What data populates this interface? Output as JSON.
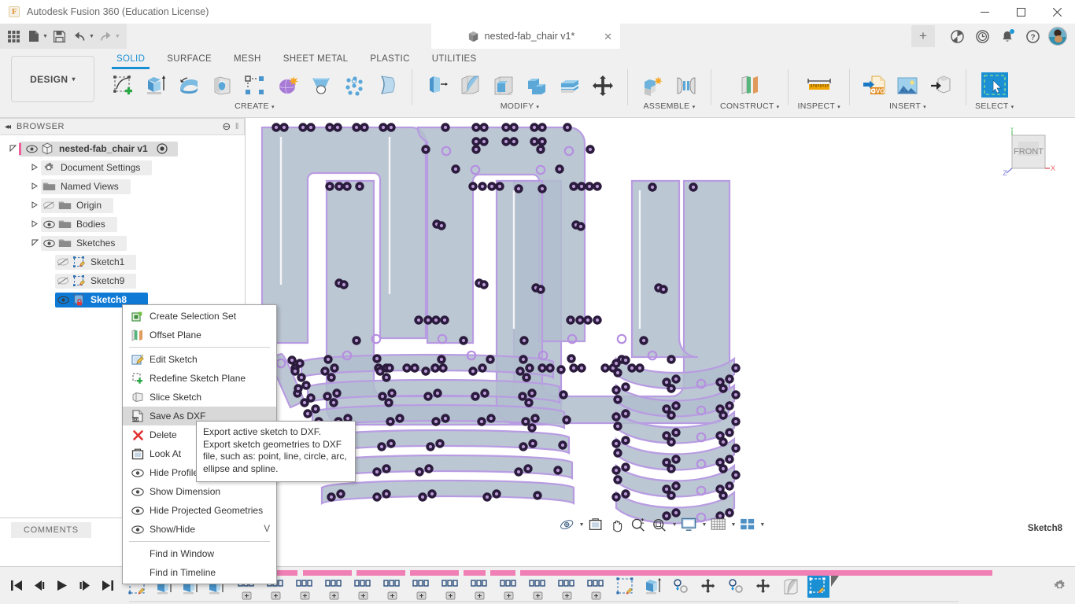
{
  "window": {
    "app_title": "Autodesk Fusion 360 (Education License)",
    "logo_letter": "F",
    "minimize": "—",
    "maximize": "☐",
    "close": "✕"
  },
  "quick_access": {
    "items": [
      {
        "name": "app-grid-icon",
        "label": "Show Data Panel"
      },
      {
        "name": "new-file-icon",
        "label": "File",
        "caret": true
      },
      {
        "name": "save-icon",
        "label": "Save"
      },
      {
        "name": "undo-icon",
        "label": "Undo",
        "caret": true
      },
      {
        "name": "redo-icon",
        "label": "Redo",
        "caret": true
      }
    ]
  },
  "document_tab": {
    "title": "nested-fab_chair v1*",
    "close": "✕",
    "new_tab": "+"
  },
  "system_icons": [
    {
      "name": "job-status-icon",
      "label": "Job Status"
    },
    {
      "name": "recent-activity-icon",
      "label": "Recent Activity"
    },
    {
      "name": "notifications-icon",
      "label": "Notifications"
    },
    {
      "name": "help-icon",
      "label": "Help"
    },
    {
      "name": "account-avatar",
      "label": "Account"
    }
  ],
  "ribbon": {
    "workspace": "DESIGN",
    "workspace_caret": "▾",
    "tabs": [
      {
        "label": "SOLID",
        "active": true
      },
      {
        "label": "SURFACE",
        "active": false
      },
      {
        "label": "MESH",
        "active": false
      },
      {
        "label": "SHEET METAL",
        "active": false
      },
      {
        "label": "PLASTIC",
        "active": false
      },
      {
        "label": "UTILITIES",
        "active": false
      }
    ],
    "panels": [
      {
        "label": "CREATE",
        "caret": "▾",
        "buttons": [
          {
            "name": "create-sketch-icon",
            "label": "Create Sketch"
          },
          {
            "name": "extrude-icon",
            "label": "Extrude"
          },
          {
            "name": "revolve-icon",
            "label": "Revolve"
          },
          {
            "name": "sweep-icon",
            "label": "Sweep"
          },
          {
            "name": "pattern-icon",
            "label": "Rectangular Pattern"
          },
          {
            "name": "create-form-icon",
            "label": "Create Form"
          },
          {
            "name": "loft-icon",
            "label": "Loft"
          },
          {
            "name": "hole-pattern-icon",
            "label": "Hole"
          },
          {
            "name": "rib-icon",
            "label": "Rib"
          }
        ]
      },
      {
        "label": "MODIFY",
        "caret": "▾",
        "buttons": [
          {
            "name": "press-pull-icon",
            "label": "Press Pull"
          },
          {
            "name": "fillet-icon",
            "label": "Fillet"
          },
          {
            "name": "shell-icon",
            "label": "Shell"
          },
          {
            "name": "combine-icon",
            "label": "Combine"
          },
          {
            "name": "split-face-icon",
            "label": "Split Face"
          },
          {
            "name": "move-copy-icon",
            "label": "Move/Copy"
          }
        ]
      },
      {
        "label": "ASSEMBLE",
        "caret": "▾",
        "buttons": [
          {
            "name": "new-component-icon",
            "label": "New Component"
          },
          {
            "name": "joint-icon",
            "label": "Joint"
          }
        ]
      },
      {
        "label": "CONSTRUCT",
        "caret": "▾",
        "buttons": [
          {
            "name": "offset-plane-icon",
            "label": "Offset Plane"
          }
        ]
      },
      {
        "label": "INSPECT",
        "caret": "▾",
        "buttons": [
          {
            "name": "measure-icon",
            "label": "Measure"
          }
        ]
      },
      {
        "label": "INSERT",
        "caret": "▾",
        "buttons": [
          {
            "name": "insert-svg-icon",
            "label": "Insert SVG"
          },
          {
            "name": "canvas-image-icon",
            "label": "Canvas"
          },
          {
            "name": "insert-derive-icon",
            "label": "Derive"
          }
        ]
      },
      {
        "label": "SELECT",
        "caret": "▾",
        "buttons": [
          {
            "name": "select-tool-icon",
            "label": "Select"
          }
        ]
      }
    ]
  },
  "browser": {
    "header": "BROWSER",
    "collapse_glyph": "◂◂",
    "minus_glyph": "⊖",
    "grip_glyph": "‖",
    "tree": [
      {
        "label": "nested-fab_chair v1",
        "depth": 0,
        "arrow": "open",
        "eye": "visible",
        "state": "root",
        "icon": "component-icon",
        "has_pink_bar": true,
        "has_target": true
      },
      {
        "label": "Document Settings",
        "depth": 1,
        "arrow": "closed",
        "eye": "none",
        "state": "normal",
        "icon": "gear-icon"
      },
      {
        "label": "Named Views",
        "depth": 1,
        "arrow": "closed",
        "eye": "none",
        "state": "normal",
        "icon": "folder-icon"
      },
      {
        "label": "Origin",
        "depth": 1,
        "arrow": "closed",
        "eye": "hidden",
        "state": "normal",
        "icon": "folder-icon"
      },
      {
        "label": "Bodies",
        "depth": 1,
        "arrow": "closed",
        "eye": "visible",
        "state": "normal",
        "icon": "folder-icon"
      },
      {
        "label": "Sketches",
        "depth": 1,
        "arrow": "open",
        "eye": "visible",
        "state": "normal",
        "icon": "folder-sketch-icon"
      },
      {
        "label": "Sketch1",
        "depth": 2,
        "arrow": "none",
        "eye": "hidden",
        "state": "normal",
        "icon": "sketch-icon"
      },
      {
        "label": "Sketch9",
        "depth": 2,
        "arrow": "none",
        "eye": "hidden",
        "state": "normal",
        "icon": "sketch-icon"
      },
      {
        "label": "Sketch8",
        "depth": 2,
        "arrow": "none",
        "eye": "visible",
        "state": "selected",
        "icon": "sketch-locked-icon"
      }
    ],
    "comments_label": "COMMENTS"
  },
  "context_menu": {
    "items": [
      {
        "label": "Create Selection Set",
        "icon": "selection-set-icon",
        "type": "item"
      },
      {
        "label": "Offset Plane",
        "icon": "offset-plane-icon",
        "type": "item"
      },
      {
        "type": "separator"
      },
      {
        "label": "Edit Sketch",
        "icon": "edit-sketch-icon",
        "type": "item"
      },
      {
        "label": "Redefine Sketch Plane",
        "icon": "redefine-plane-icon",
        "type": "item"
      },
      {
        "label": "Slice Sketch",
        "icon": "slice-sketch-icon",
        "type": "item"
      },
      {
        "label": "Save As DXF",
        "icon": "dxf-icon",
        "type": "item",
        "highlighted": true
      },
      {
        "label": "Delete",
        "icon": "delete-icon",
        "type": "item"
      },
      {
        "label": "Look At",
        "icon": "look-at-icon",
        "type": "item"
      },
      {
        "label": "Hide Profile",
        "icon": "eye-icon",
        "type": "item"
      },
      {
        "label": "Show Dimension",
        "icon": "eye-icon",
        "type": "item"
      },
      {
        "label": "Hide Projected Geometries",
        "icon": "eye-icon",
        "type": "item"
      },
      {
        "label": "Show/Hide",
        "icon": "eye-icon",
        "type": "item",
        "shortcut": "V"
      },
      {
        "type": "separator"
      },
      {
        "label": "Find in Window",
        "icon": "none",
        "type": "item"
      },
      {
        "label": "Find in Timeline",
        "icon": "none",
        "type": "item"
      }
    ]
  },
  "tooltip": {
    "text": "Export active sketch to DXF. Export sketch geometries to DXF file, such as: point, line, circle, arc, ellipse and spline."
  },
  "canvas": {
    "view_cube_face": "FRONT",
    "axis_x": "X",
    "axis_y": "Y",
    "axis_z": "Z",
    "status_text": "Sketch8",
    "nav_buttons": [
      {
        "name": "orbit-icon",
        "label": "Orbit",
        "caret": true
      },
      {
        "name": "look-at-icon",
        "label": "Look At",
        "caret": false
      },
      {
        "name": "pan-icon",
        "label": "Pan",
        "caret": false
      },
      {
        "name": "zoom-icon",
        "label": "Zoom",
        "caret": false
      },
      {
        "name": "fit-icon",
        "label": "Fit",
        "caret": true
      },
      {
        "name": "display-settings-icon",
        "label": "Display Settings",
        "caret": true
      },
      {
        "name": "grid-snap-icon",
        "label": "Grid and Snaps",
        "caret": true
      },
      {
        "name": "viewports-icon",
        "label": "Viewports",
        "caret": true
      }
    ]
  },
  "timeline": {
    "playback": [
      {
        "name": "go-to-beginning-icon",
        "label": "Go to Beginning",
        "glyph": "⏮"
      },
      {
        "name": "step-back-icon",
        "label": "Step Back",
        "glyph": "◀❘"
      },
      {
        "name": "play-icon",
        "label": "Play",
        "glyph": "▶"
      },
      {
        "name": "step-forward-icon",
        "label": "Step Forward",
        "glyph": "❘▶"
      },
      {
        "name": "go-to-end-icon",
        "label": "Go to End",
        "glyph": "⏭"
      }
    ],
    "features": [
      {
        "icon": "sketch-icon",
        "group": 0
      },
      {
        "icon": "extrude-icon",
        "group": 0
      },
      {
        "icon": "extrude-icon",
        "group": 0
      },
      {
        "icon": "extrude-icon",
        "group": 0
      },
      {
        "icon": "pattern-group-icon",
        "group": 1
      },
      {
        "icon": "pattern-group-icon",
        "group": 1
      },
      {
        "icon": "pattern-group-icon",
        "group": 1
      },
      {
        "icon": "pattern-group-icon",
        "group": 1
      },
      {
        "icon": "pattern-group-icon",
        "group": 1
      },
      {
        "icon": "pattern-group-icon",
        "group": 1
      },
      {
        "icon": "pattern-group-icon",
        "group": 1
      },
      {
        "icon": "pattern-group-icon",
        "group": 1
      },
      {
        "icon": "pattern-group-icon",
        "group": 1
      },
      {
        "icon": "pattern-group-icon",
        "group": 1
      },
      {
        "icon": "pattern-group-icon",
        "group": 1
      },
      {
        "icon": "pattern-group-icon",
        "group": 1
      },
      {
        "icon": "pattern-group-icon",
        "group": 1
      },
      {
        "icon": "sketch-icon",
        "group": 2
      },
      {
        "icon": "extrude-icon",
        "group": 2
      },
      {
        "icon": "joint-icon",
        "group": 2
      },
      {
        "icon": "move-icon",
        "group": 2
      },
      {
        "icon": "joint-icon",
        "group": 2
      },
      {
        "icon": "move-icon",
        "group": 2
      },
      {
        "icon": "fillet-icon",
        "group": 2
      },
      {
        "icon": "sketch-active-icon",
        "group": 2,
        "active": true
      }
    ],
    "settings_icon": "gear-icon"
  }
}
